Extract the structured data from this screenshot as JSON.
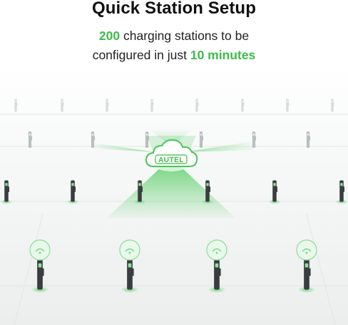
{
  "header": {
    "title": "Quick Station Setup",
    "line1_highlight": "200",
    "line1_text": " charging stations to be",
    "line2_text": "configured in just ",
    "line2_highlight": "10 minutes"
  },
  "cloud": {
    "logo_text": "AUTEL"
  },
  "colors": {
    "accent": "#3dbb4b",
    "beam": "#5fd36c",
    "floor": "#eef0f0",
    "charger_body": "#3a3d40"
  },
  "icons": [
    "cloud-icon",
    "ev-charger-icon",
    "wifi-signal-icon"
  ]
}
